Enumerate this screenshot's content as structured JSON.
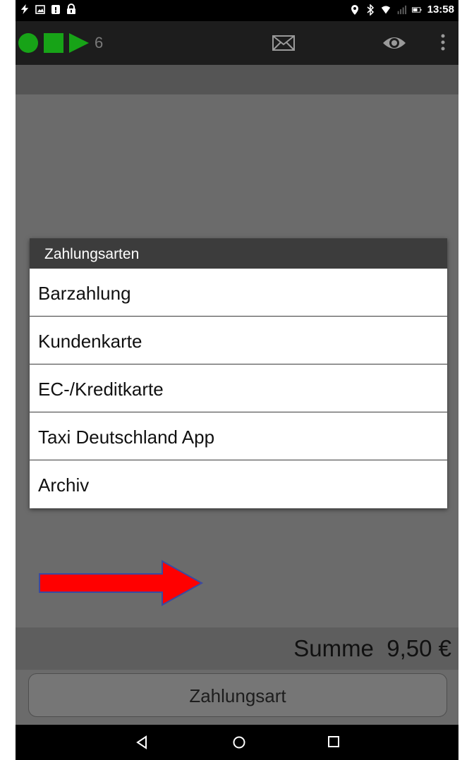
{
  "status_bar": {
    "time": "13:58",
    "left_icons": [
      "bolt-icon",
      "image-icon",
      "badge-icon",
      "lock-icon"
    ],
    "right_icons": [
      "location-icon",
      "bluetooth-icon",
      "wifi-icon",
      "signal-icon",
      "battery-icon"
    ]
  },
  "action_bar": {
    "counter": "6",
    "status_colors": {
      "dot": "#17a317",
      "square": "#17a317",
      "play": "#17a317"
    },
    "icons": [
      "mail-icon",
      "eye-icon",
      "more-vert-icon"
    ]
  },
  "dialog": {
    "title": "Zahlungsarten",
    "options": [
      {
        "label": "Barzahlung"
      },
      {
        "label": "Kundenkarte"
      },
      {
        "label": "EC-/Kreditkarte"
      },
      {
        "label": "Taxi Deutschland App"
      },
      {
        "label": "Archiv"
      }
    ]
  },
  "annotation": {
    "arrow_color": "#ff0000",
    "arrow_outline": "#3b4aa0"
  },
  "sum": {
    "label": "Summe  9,50 €"
  },
  "payment_button": {
    "label": "Zahlungsart"
  },
  "nav_bar": {
    "icons": [
      "back-icon",
      "home-icon",
      "recent-apps-icon"
    ]
  }
}
